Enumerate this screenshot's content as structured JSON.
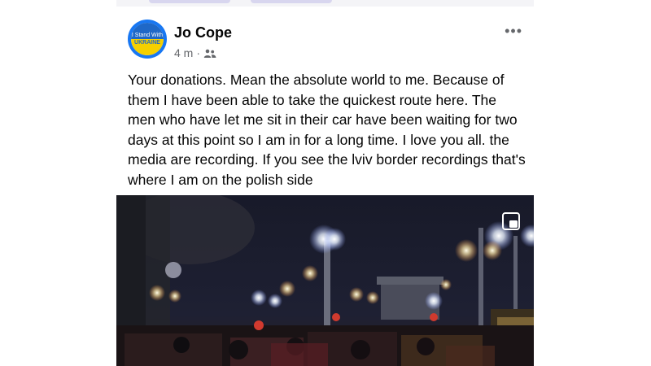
{
  "post": {
    "author": "Jo Cope",
    "time": "4 m",
    "separator": "·",
    "audience_icon": "friends-icon",
    "more_icon": "more-options-icon",
    "more_label": "•••",
    "avatar_text_top": "I Stand With",
    "avatar_text_bottom": "UKRAINE",
    "text": "Your donations. Mean the absolute world to me. Because of them I have been able to take the quickest route here. The men who have let me sit in their car have been waiting for two days at this point so I am in for a long time.  I love you all. the media are recording. If you see the lviv border recordings that's where I am on the polish side"
  },
  "photo": {
    "fullscreen_icon": "expand-icon"
  },
  "colors": {
    "accent": "#1877f2",
    "text": "#050505",
    "secondary": "#65676b",
    "ukraine_blue": "#1f68c7",
    "ukraine_yellow": "#f5d000"
  }
}
